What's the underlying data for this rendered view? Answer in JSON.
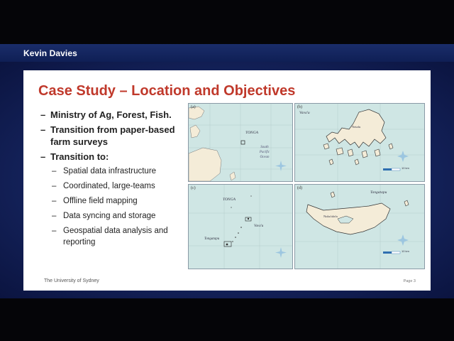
{
  "header": {
    "presenter": "Kevin Davies"
  },
  "slide": {
    "title": "Case Study – Location and Objectives",
    "bullets": [
      {
        "text": "Ministry of Ag, Forest, Fish."
      },
      {
        "text": "Transition from paper-based farm surveys"
      },
      {
        "text": "Transition to:"
      }
    ],
    "sub_bullets": [
      "Spatial data infrastructure",
      "Coordinated, large-teams",
      "Offline field mapping",
      "Data syncing and storage",
      "Geospatial data analysis and reporting"
    ],
    "footer": "The University of Sydney",
    "page": "Page 3"
  },
  "maps": {
    "a": {
      "label": "(a)",
      "country": "TONGA",
      "ocean": "South Pacific Ocean"
    },
    "b": {
      "label": "(b)",
      "place": "Vava'u",
      "town": "Neiafu",
      "scale": "10 km"
    },
    "c": {
      "label": "(c)",
      "country": "TONGA",
      "place1": "Vava'u",
      "place2": "Tongatapu"
    },
    "d": {
      "label": "(d)",
      "place": "Tongatapu",
      "town": "Nuku'alofa",
      "scale": "10 km"
    }
  },
  "colors": {
    "header": "#1a2d6a",
    "title": "#c0392b",
    "sea": "#cfe6e4",
    "land": "#f4ecd8"
  }
}
